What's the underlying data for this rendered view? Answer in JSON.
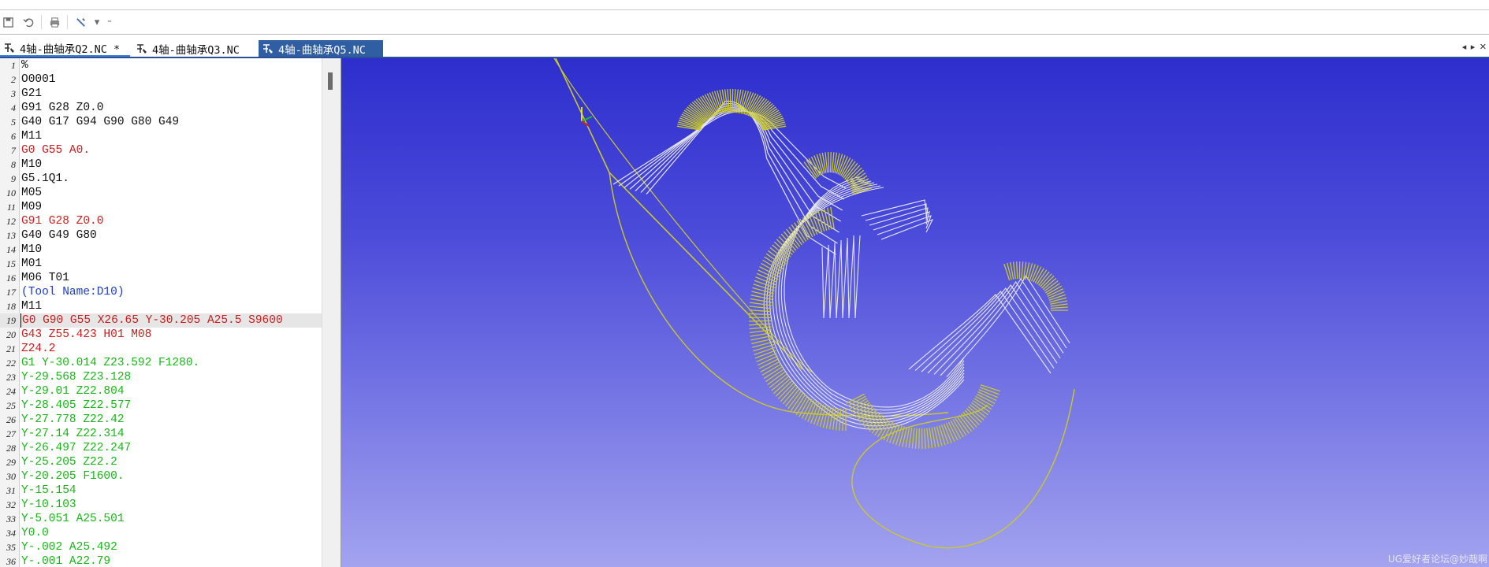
{
  "window": {
    "tabs": [
      {
        "label": "4轴-曲轴承Q2.NC *",
        "active": false
      },
      {
        "label": "4轴-曲轴承Q3.NC",
        "active": false
      },
      {
        "label": "4轴-曲轴承Q5.NC",
        "active": true
      }
    ],
    "tab_scroll_glyphs": "◂ ▸ ✕"
  },
  "toolbar": {
    "icons": [
      "save-icon",
      "undo-icon",
      "print-icon",
      "tool-icon",
      "dropdown-arrow-icon",
      "customize-icon"
    ]
  },
  "editor": {
    "highlighted_line": 19,
    "lines": [
      {
        "n": "1",
        "text": "%",
        "color": "black"
      },
      {
        "n": "2",
        "text": "O0001",
        "color": "black"
      },
      {
        "n": "3",
        "text": "G21",
        "color": "black"
      },
      {
        "n": "4",
        "text": "G91 G28 Z0.0",
        "color": "black"
      },
      {
        "n": "5",
        "text": "G40 G17 G94 G90 G80 G49",
        "color": "black"
      },
      {
        "n": "6",
        "text": "M11",
        "color": "black"
      },
      {
        "n": "7",
        "text": "G0 G55 A0.",
        "color": "red"
      },
      {
        "n": "8",
        "text": "M10",
        "color": "black"
      },
      {
        "n": "9",
        "text": "G5.1Q1.",
        "color": "black"
      },
      {
        "n": "10",
        "text": "M05",
        "color": "black"
      },
      {
        "n": "11",
        "text": "M09",
        "color": "black"
      },
      {
        "n": "12",
        "text": "G91 G28 Z0.0",
        "color": "red"
      },
      {
        "n": "13",
        "text": "G40 G49 G80",
        "color": "black"
      },
      {
        "n": "14",
        "text": "M10",
        "color": "black"
      },
      {
        "n": "15",
        "text": "M01",
        "color": "black"
      },
      {
        "n": "16",
        "text": "M06 T01",
        "color": "black"
      },
      {
        "n": "17",
        "text": "(Tool Name:D10)",
        "color": "blue"
      },
      {
        "n": "18",
        "text": "M11",
        "color": "black"
      },
      {
        "n": "19",
        "text": "G0 G90 G55 X26.65 Y-30.205 A25.5 S9600",
        "color": "red"
      },
      {
        "n": "20",
        "text": "G43 Z55.423 H01 M08",
        "color": "red"
      },
      {
        "n": "21",
        "text": "Z24.2",
        "color": "red"
      },
      {
        "n": "22",
        "text": "G1 Y-30.014 Z23.592 F1280.",
        "color": "green"
      },
      {
        "n": "23",
        "text": "Y-29.568 Z23.128",
        "color": "green"
      },
      {
        "n": "24",
        "text": "Y-29.01 Z22.804",
        "color": "green"
      },
      {
        "n": "25",
        "text": "Y-28.405 Z22.577",
        "color": "green"
      },
      {
        "n": "26",
        "text": "Y-27.778 Z22.42",
        "color": "green"
      },
      {
        "n": "27",
        "text": "Y-27.14 Z22.314",
        "color": "green"
      },
      {
        "n": "28",
        "text": "Y-26.497 Z22.247",
        "color": "green"
      },
      {
        "n": "29",
        "text": "Y-25.205 Z22.2",
        "color": "green"
      },
      {
        "n": "30",
        "text": "Y-20.205 F1600.",
        "color": "green"
      },
      {
        "n": "31",
        "text": "Y-15.154",
        "color": "green"
      },
      {
        "n": "32",
        "text": "Y-10.103",
        "color": "green"
      },
      {
        "n": "33",
        "text": "Y-5.051 A25.501",
        "color": "green"
      },
      {
        "n": "34",
        "text": "Y0.0",
        "color": "green"
      },
      {
        "n": "35",
        "text": "Y-.002 A25.492",
        "color": "green"
      },
      {
        "n": "36",
        "text": "Y-.001 A22.79",
        "color": "green"
      }
    ]
  },
  "viewport": {
    "watermark": "UG爱好者论坛@妙哉啊",
    "background_top": "#2e2ece",
    "background_bottom": "#a3a3ef",
    "toolpath_color": "#e6e6ee",
    "tool_axis_color": "#c9c92a"
  },
  "colors": {
    "black": "#111111",
    "red": "#c81e1e",
    "green": "#19b419",
    "blue": "#1e3cc8"
  }
}
